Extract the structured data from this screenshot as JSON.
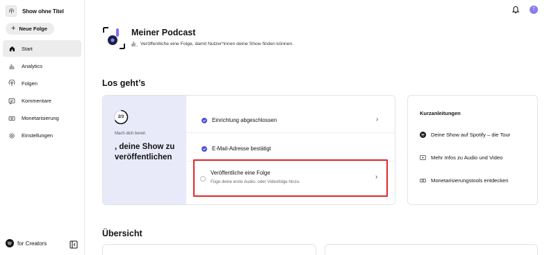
{
  "sidebar": {
    "show_title": "Show ohne Titel",
    "new_episode": "Neue Folge",
    "items": [
      {
        "label": "Start",
        "icon": "home-icon",
        "active": true
      },
      {
        "label": "Analytics",
        "icon": "analytics-icon"
      },
      {
        "label": "Folgen",
        "icon": "podcast-icon"
      },
      {
        "label": "Kommentare",
        "icon": "comment-icon"
      },
      {
        "label": "Monetarisierung",
        "icon": "money-icon"
      },
      {
        "label": "Einstellungen",
        "icon": "gear-icon"
      }
    ],
    "footer_label": "for Creators"
  },
  "header": {
    "avatar_letter": "T"
  },
  "podcast": {
    "title": "Meiner Podcast",
    "subtitle": "Veröffentliche eine Folge, damit Nutzer*innen deine Show finden können."
  },
  "onboarding": {
    "heading": "Los geht’s",
    "progress_text": "2/3",
    "progress_fraction": 0.667,
    "ready_label": "Mach dich bereit",
    "big_text": ", deine Show zu veröffentlichen",
    "steps": [
      {
        "title": "Einrichtung abgeschlossen",
        "done": true
      },
      {
        "title": "E-Mail-Adresse bestätigt",
        "done": true
      },
      {
        "title": "Veröffentliche eine Folge",
        "subtitle": "Füge deine erste Audio- oder Videofolge hinzu.",
        "done": false
      }
    ]
  },
  "guides": {
    "heading": "Kurzanleitungen",
    "items": [
      {
        "label": "Deine Show auf Spotify – die Tour",
        "icon": "spotify-icon"
      },
      {
        "label": "Mehr Infos zu Audio und Video",
        "icon": "play-icon"
      },
      {
        "label": "Monetarisierungstools entdecken",
        "icon": "money-icon"
      }
    ]
  },
  "overview": {
    "heading": "Übersicht"
  },
  "colors": {
    "accent": "#4a4fd6",
    "highlight": "#e0262a",
    "card_left_bg": "#e9eaf9"
  }
}
